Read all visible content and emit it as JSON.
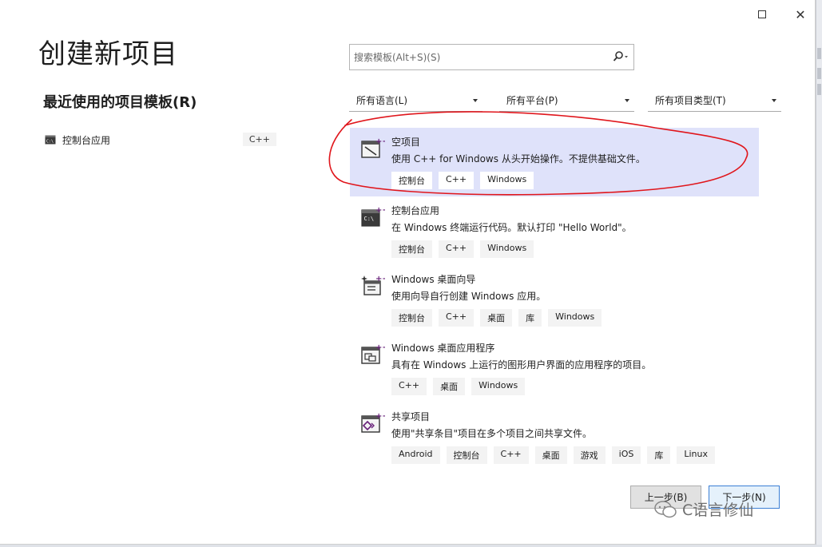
{
  "window": {
    "title": "创建新项目",
    "maximize_label": "",
    "close_label": "✕"
  },
  "recent": {
    "heading": "最近使用的项目模板(R)",
    "items": [
      {
        "label": "控制台应用",
        "tag": "C++"
      }
    ]
  },
  "search": {
    "placeholder": "搜索模板(Alt+S)(S)",
    "value": ""
  },
  "filters": {
    "language": "所有语言(L)",
    "platform": "所有平台(P)",
    "project_type": "所有项目类型(T)"
  },
  "templates": [
    {
      "name": "空项目",
      "description": "使用 C++ for Windows 从头开始操作。不提供基础文件。",
      "tags": [
        "控制台",
        "C++",
        "Windows"
      ],
      "icon": "empty-project-icon",
      "selected": true
    },
    {
      "name": "控制台应用",
      "description": "在 Windows 终端运行代码。默认打印 \"Hello World\"。",
      "tags": [
        "控制台",
        "C++",
        "Windows"
      ],
      "icon": "console-app-icon",
      "selected": false
    },
    {
      "name": "Windows 桌面向导",
      "description": "使用向导自行创建 Windows 应用。",
      "tags": [
        "控制台",
        "C++",
        "桌面",
        "库",
        "Windows"
      ],
      "icon": "desktop-wizard-icon",
      "selected": false
    },
    {
      "name": "Windows 桌面应用程序",
      "description": "具有在 Windows 上运行的图形用户界面的应用程序的项目。",
      "tags": [
        "C++",
        "桌面",
        "Windows"
      ],
      "icon": "desktop-app-icon",
      "selected": false
    },
    {
      "name": "共享项目",
      "description": "使用\"共享条目\"项目在多个项目之间共享文件。",
      "tags": [
        "Android",
        "控制台",
        "C++",
        "桌面",
        "游戏",
        "iOS",
        "库",
        "Linux"
      ],
      "icon": "shared-project-icon",
      "selected": false
    }
  ],
  "buttons": {
    "back": "上一步(B)",
    "next": "下一步(N)"
  },
  "watermark": {
    "text": "C语言修仙"
  },
  "colors": {
    "selected_background": "#dfe2fa",
    "accent_purple": "#68217a",
    "annotation_red": "#e0161c",
    "primary_border": "#3c7fd5"
  }
}
